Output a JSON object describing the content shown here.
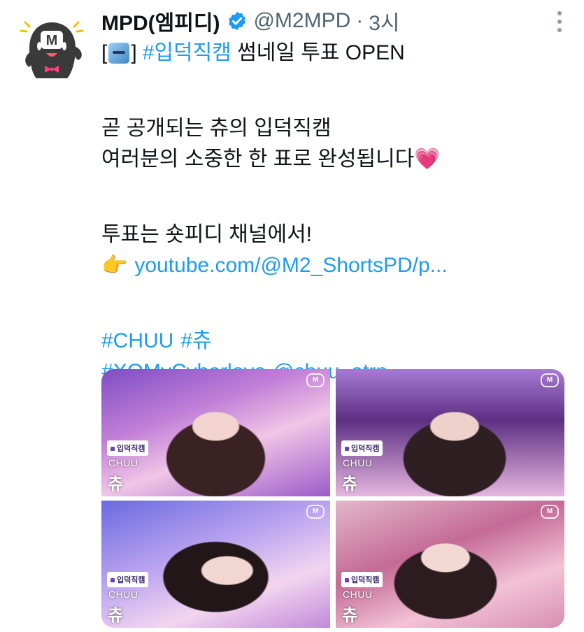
{
  "author": {
    "display_name": "MPD(엠피디)",
    "handle": "@M2MPD",
    "separator": "·",
    "time": "3시",
    "verified_icon": "verified-badge-icon",
    "avatar_icon": "mpd-mascot-avatar"
  },
  "tweet": {
    "line1": {
      "bracket_open": "[",
      "emoji": "ballot-box-icon",
      "bracket_close": "]",
      "hashtag": "#입덕직캠",
      "rest": " 썸네일 투표 OPEN"
    },
    "line2": "곧 공개되는 츄의 입덕직캠",
    "line3": "여러분의 소중한 한 표로 완성됩니다",
    "line3_emoji": "💗",
    "line4": "투표는 숏피디 채널에서!",
    "link_emoji": "👉",
    "link": "youtube.com/@M2_ShortsPD/p...",
    "hashtags_line1": [
      "#CHUU",
      "#츄"
    ],
    "hashtags_line2": "#XOMyCyberlove",
    "mention": "@chuu_atrp"
  },
  "media": [
    {
      "badge": "입덕직캠",
      "caption_en": "CHUU",
      "caption_ko": "츄"
    },
    {
      "badge": "입덕직캠",
      "caption_en": "CHUU",
      "caption_ko": "츄"
    },
    {
      "badge": "입덕직캠",
      "caption_en": "CHUU",
      "caption_ko": "츄"
    },
    {
      "badge": "입덕직캠",
      "caption_en": "CHUU",
      "caption_ko": "츄"
    }
  ],
  "colors": {
    "link": "#1d9bf0",
    "secondary_text": "#536471",
    "verified": "#1d9bf0"
  }
}
